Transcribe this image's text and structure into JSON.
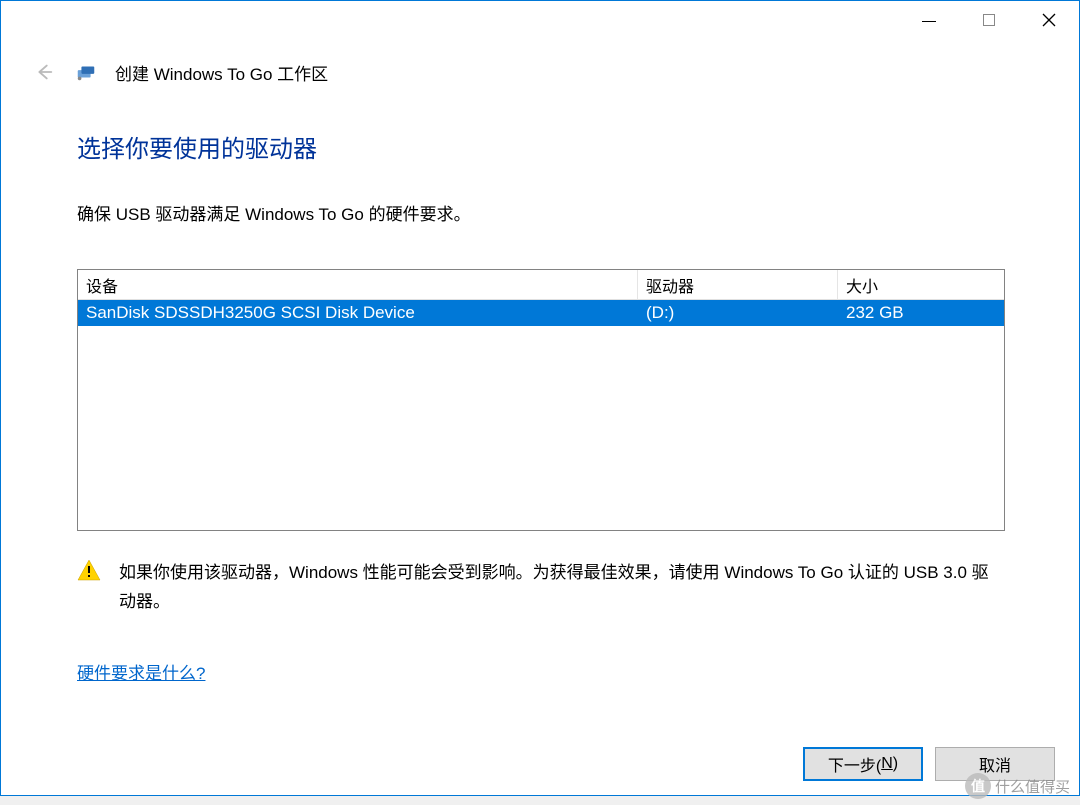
{
  "titlebar": {
    "title": "创建 Windows To Go 工作区"
  },
  "page": {
    "heading": "选择你要使用的驱动器",
    "subtext": "确保 USB 驱动器满足 Windows To Go 的硬件要求。"
  },
  "table": {
    "headers": {
      "device": "设备",
      "drive": "驱动器",
      "size": "大小"
    },
    "rows": [
      {
        "device": "SanDisk SDSSDH3250G SCSI Disk Device",
        "drive": "(D:)",
        "size": "232 GB",
        "selected": true
      }
    ]
  },
  "warning": "如果你使用该驱动器，Windows 性能可能会受到影响。为获得最佳效果，请使用 Windows To Go 认证的 USB 3.0 驱动器。",
  "link": "硬件要求是什么?",
  "buttons": {
    "next_prefix": "下一步(",
    "next_mnemonic": "N",
    "next_suffix": ")",
    "cancel": "取消"
  },
  "watermark": {
    "char": "值",
    "text": "什么值得买"
  }
}
